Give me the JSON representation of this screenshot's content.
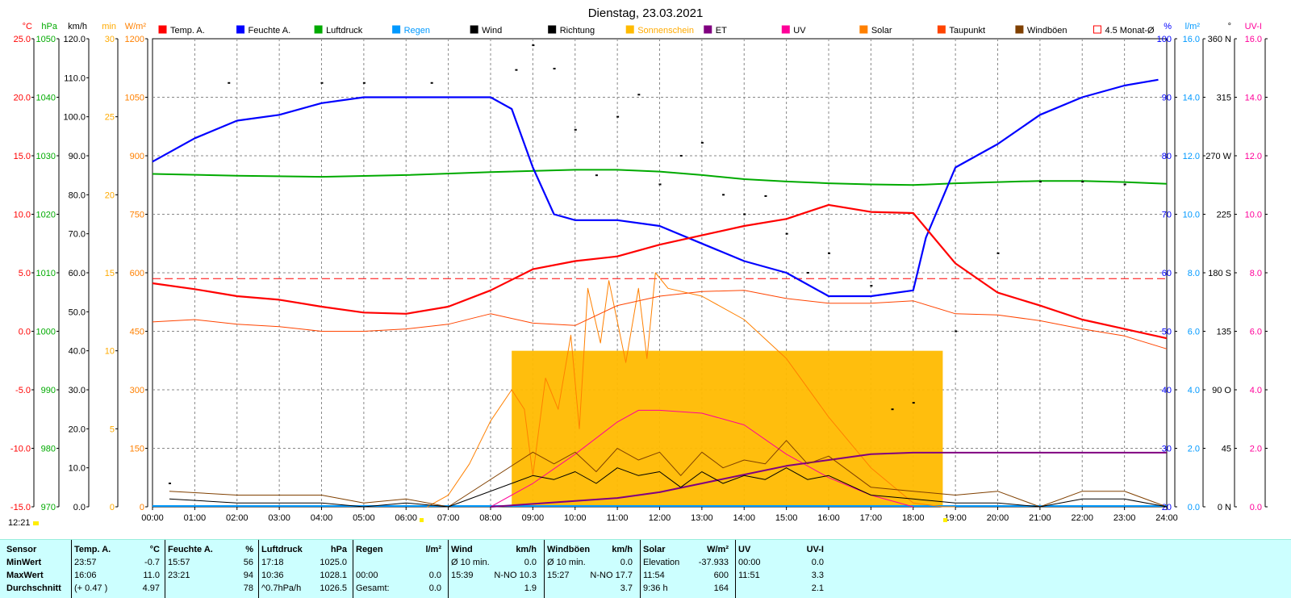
{
  "title": "Dienstag, 23.03.2021",
  "time_now": "12:21",
  "legend": [
    {
      "label": "Temp. A.",
      "color": "#ff0000"
    },
    {
      "label": "Feuchte A.",
      "color": "#0000ff"
    },
    {
      "label": "Luftdruck",
      "color": "#00aa00"
    },
    {
      "label": "Regen",
      "color": "#0099ff"
    },
    {
      "label": "Wind",
      "color": "#000000"
    },
    {
      "label": "Richtung",
      "color": "#000000"
    },
    {
      "label": "Sonnenschein",
      "color": "#ffbb00"
    },
    {
      "label": "ET",
      "color": "#800080"
    },
    {
      "label": "UV",
      "color": "#ff0099"
    },
    {
      "label": "Solar",
      "color": "#ff8000"
    },
    {
      "label": "Taupunkt",
      "color": "#ff4400"
    },
    {
      "label": "Windböen",
      "color": "#804000"
    },
    {
      "label": "4.5 Monat-Ø",
      "color": "#ff0000"
    }
  ],
  "axes_left": [
    {
      "unit": "°C",
      "color": "#ff0000",
      "ticks": [
        "25.0",
        "20.0",
        "15.0",
        "10.0",
        "5.0",
        "0.0",
        "-5.0",
        "-10.0",
        "-15.0"
      ]
    },
    {
      "unit": "hPa",
      "color": "#00aa00",
      "ticks": [
        "1050",
        "1040",
        "1030",
        "1020",
        "1010",
        "1000",
        "990",
        "980",
        "970"
      ]
    },
    {
      "unit": "km/h",
      "color": "#000000",
      "ticks": [
        "120.0",
        "110.0",
        "100.0",
        "90.0",
        "80.0",
        "70.0",
        "60.0",
        "50.0",
        "40.0",
        "30.0",
        "20.0",
        "10.0",
        "0.0"
      ]
    },
    {
      "unit": "min",
      "color": "#ffaa00",
      "ticks": [
        "30",
        "25",
        "20",
        "15",
        "10",
        "5",
        "0"
      ]
    },
    {
      "unit": "W/m²",
      "color": "#ff8000",
      "ticks": [
        "1200",
        "1050",
        "900",
        "750",
        "600",
        "450",
        "300",
        "150",
        "0"
      ]
    }
  ],
  "axes_right": [
    {
      "unit": "%",
      "color": "#0000ff",
      "ticks": [
        "100",
        "90",
        "80",
        "70",
        "60",
        "50",
        "40",
        "30",
        "20"
      ]
    },
    {
      "unit": "l/m²",
      "color": "#0099ff",
      "ticks": [
        "16.0",
        "14.0",
        "12.0",
        "10.0",
        "8.0",
        "6.0",
        "4.0",
        "2.0",
        "0.0"
      ]
    },
    {
      "unit": "°",
      "color": "#000000",
      "ticks": [
        "360 N",
        "315",
        "270 W",
        "225",
        "180 S",
        "135",
        "90 O",
        "45",
        "0 N"
      ]
    },
    {
      "unit": "UV-I",
      "color": "#ff0099",
      "ticks": [
        "16.0",
        "14.0",
        "12.0",
        "10.0",
        "8.0",
        "6.0",
        "4.0",
        "2.0",
        "0.0"
      ]
    }
  ],
  "chart_data": {
    "type": "line",
    "title": "Dienstag, 23.03.2021",
    "x_ticks": [
      "00:00",
      "01:00",
      "02:00",
      "03:00",
      "04:00",
      "05:00",
      "06:00",
      "07:00",
      "08:00",
      "09:00",
      "10:00",
      "11:00",
      "12:00",
      "13:00",
      "14:00",
      "15:00",
      "16:00",
      "17:00",
      "18:00",
      "19:00",
      "20:00",
      "21:00",
      "22:00",
      "23:00",
      "24:00"
    ],
    "xlim": [
      0,
      24
    ],
    "grid": true,
    "legend_placement": "top",
    "series": [
      {
        "name": "Temp. A.",
        "unit": "°C",
        "color": "#ff0000",
        "ylim": [
          -15,
          25
        ],
        "x": [
          0,
          1,
          2,
          3,
          4,
          5,
          6,
          7,
          8,
          9,
          10,
          11,
          12,
          13,
          14,
          15,
          16,
          17,
          18,
          19,
          20,
          21,
          22,
          23,
          24
        ],
        "y": [
          4.1,
          3.6,
          3.0,
          2.7,
          2.1,
          1.6,
          1.5,
          2.1,
          3.5,
          5.3,
          6.0,
          6.4,
          7.4,
          8.2,
          9.0,
          9.6,
          10.8,
          10.2,
          10.1,
          5.8,
          3.3,
          2.2,
          1.0,
          0.2,
          -0.6
        ]
      },
      {
        "name": "Feuchte A.",
        "unit": "%",
        "color": "#0000ff",
        "ylim": [
          20,
          100
        ],
        "x": [
          0,
          1,
          2,
          3,
          4,
          5,
          6,
          7,
          8,
          8.5,
          9,
          9.5,
          10,
          11,
          12,
          13,
          14,
          15,
          16,
          17,
          18,
          18.3,
          19,
          20,
          21,
          22,
          23,
          23.8
        ],
        "y": [
          79,
          83,
          86,
          87,
          89,
          90,
          90,
          90,
          90,
          88,
          78,
          70,
          69,
          69,
          68,
          65,
          62,
          60,
          56,
          56,
          57,
          66,
          78,
          82,
          87,
          90,
          92,
          93
        ]
      },
      {
        "name": "Luftdruck",
        "unit": "hPa",
        "color": "#00aa00",
        "ylim": [
          970,
          1050
        ],
        "x": [
          0,
          2,
          4,
          6,
          8,
          10,
          11,
          12,
          13,
          14,
          15,
          16,
          17,
          18,
          19,
          20,
          21,
          22,
          23,
          24
        ],
        "y": [
          1026.9,
          1026.6,
          1026.4,
          1026.7,
          1027.2,
          1027.6,
          1027.6,
          1027.3,
          1026.7,
          1026.0,
          1025.6,
          1025.3,
          1025.1,
          1025.0,
          1025.3,
          1025.5,
          1025.7,
          1025.7,
          1025.5,
          1025.2
        ]
      },
      {
        "name": "Solar",
        "unit": "W/m²",
        "color": "#ff8000",
        "ylim": [
          0,
          1200
        ],
        "x": [
          6.5,
          7,
          7.5,
          8,
          8.5,
          8.8,
          9,
          9.3,
          9.6,
          9.9,
          10.1,
          10.3,
          10.6,
          10.8,
          11.2,
          11.5,
          11.7,
          11.9,
          12.2,
          13,
          14,
          15,
          16,
          17,
          18,
          18.7,
          19
        ],
        "y": [
          0,
          30,
          110,
          220,
          300,
          250,
          80,
          330,
          250,
          440,
          200,
          560,
          420,
          580,
          370,
          560,
          380,
          600,
          560,
          540,
          480,
          380,
          230,
          100,
          10,
          0,
          0
        ]
      },
      {
        "name": "Taupunkt",
        "unit": "°C",
        "color": "#ff4400",
        "ylim": [
          -15,
          25
        ],
        "x": [
          0,
          1,
          2,
          3,
          4,
          5,
          6,
          7,
          8,
          9,
          10,
          11,
          12,
          13,
          14,
          15,
          16,
          17,
          18,
          19,
          20,
          21,
          22,
          23,
          24
        ],
        "y": [
          0.8,
          1.0,
          0.6,
          0.4,
          0.0,
          0.0,
          0.2,
          0.6,
          1.5,
          0.7,
          0.5,
          2.2,
          3.0,
          3.4,
          3.5,
          2.8,
          2.4,
          2.4,
          2.6,
          1.5,
          1.4,
          0.9,
          0.2,
          -0.4,
          -1.5
        ]
      },
      {
        "name": "UV",
        "unit": "UV-I",
        "color": "#ff0099",
        "ylim": [
          0,
          16
        ],
        "x": [
          8,
          9,
          10,
          11,
          11.5,
          12,
          13,
          14,
          15,
          16,
          17,
          18
        ],
        "y": [
          0,
          0.8,
          1.8,
          2.9,
          3.3,
          3.3,
          3.2,
          2.8,
          1.8,
          1.0,
          0.4,
          0
        ]
      },
      {
        "name": "ET",
        "unit": "l/m²",
        "color": "#800080",
        "ylim": [
          0,
          16
        ],
        "x": [
          8,
          9,
          10,
          11,
          12,
          13,
          14,
          15,
          16,
          17,
          18,
          19,
          24
        ],
        "y": [
          0,
          0.1,
          0.2,
          0.3,
          0.5,
          0.8,
          1.1,
          1.4,
          1.6,
          1.8,
          1.85,
          1.85,
          1.85
        ]
      },
      {
        "name": "Sonnenschein",
        "unit": "min",
        "color": "#ffbb00",
        "ylim": [
          0,
          30
        ],
        "x": [
          8.5,
          18.7
        ],
        "y": [
          10,
          10
        ]
      },
      {
        "name": "Wind",
        "unit": "km/h",
        "color": "#000000",
        "ylim": [
          0,
          120
        ],
        "x": [
          0.4,
          2,
          4,
          5,
          6,
          7,
          9,
          9.5,
          10,
          10.5,
          11,
          11.5,
          12,
          12.5,
          13,
          13.5,
          14,
          14.5,
          15,
          15.5,
          16,
          17,
          18,
          19,
          20,
          21,
          22,
          23,
          24
        ],
        "y": [
          2,
          1,
          1,
          0,
          1,
          0,
          8,
          7,
          9,
          6,
          10,
          8,
          9,
          5,
          9,
          6,
          8,
          7,
          10,
          7,
          8,
          3,
          2,
          1,
          1,
          0,
          2,
          2,
          0
        ]
      },
      {
        "name": "Windböen",
        "unit": "km/h",
        "color": "#804000",
        "ylim": [
          0,
          120
        ],
        "x": [
          0.4,
          2,
          4,
          5,
          6,
          7,
          9,
          9.5,
          10,
          10.5,
          11,
          11.5,
          12,
          12.5,
          13,
          13.5,
          14,
          14.5,
          15,
          15.5,
          16,
          17,
          18,
          19,
          20,
          21,
          22,
          23,
          24
        ],
        "y": [
          4,
          3,
          3,
          1,
          2,
          0,
          14,
          11,
          14,
          9,
          15,
          12,
          14,
          8,
          14,
          10,
          12,
          11,
          17,
          11,
          13,
          5,
          4,
          3,
          4,
          0,
          4,
          4,
          0
        ]
      },
      {
        "name": "Richtung",
        "unit": "°",
        "color": "#000000",
        "ylim": [
          0,
          360
        ],
        "x": [
          0.4,
          1.8,
          4,
          5,
          6.6,
          8.6,
          9,
          9.5,
          10,
          10.5,
          11,
          11.5,
          12,
          12.5,
          13,
          13.5,
          14,
          14.5,
          15,
          15.5,
          16,
          17,
          17.5,
          18,
          19,
          20,
          21,
          22,
          23
        ],
        "y": [
          18,
          326,
          326,
          326,
          326,
          336,
          355,
          337,
          290,
          255,
          300,
          317,
          248,
          270,
          280,
          240,
          225,
          239,
          210,
          180,
          195,
          170,
          75,
          80,
          135,
          195,
          250,
          250,
          248
        ]
      },
      {
        "name": "4.5 Monat-Ø",
        "unit": "°C",
        "color": "#ff0000",
        "ylim": [
          -15,
          25
        ],
        "x": [
          0,
          24
        ],
        "y": [
          4.5,
          4.5
        ]
      }
    ]
  },
  "table": {
    "row_labels": [
      "Sensor",
      "MinWert",
      "MaxWert",
      "Durchschnitt"
    ],
    "columns": [
      {
        "header": "Temp. A.",
        "unit": "°C",
        "rows": [
          [
            "23:57",
            "-0.7"
          ],
          [
            "16:06",
            "11.0"
          ],
          [
            "(+ 0.47 )",
            "4.97"
          ]
        ]
      },
      {
        "header": "Feuchte A.",
        "unit": "%",
        "rows": [
          [
            "15:57",
            "56"
          ],
          [
            "23:21",
            "94"
          ],
          [
            "",
            "78"
          ]
        ]
      },
      {
        "header": "Luftdruck",
        "unit": "hPa",
        "rows": [
          [
            "17:18",
            "1025.0"
          ],
          [
            "10:36",
            "1028.1"
          ],
          [
            "^0.7hPa/h",
            "1026.5"
          ]
        ]
      },
      {
        "header": "Regen",
        "unit": "l/m²",
        "rows": [
          [
            "",
            ""
          ],
          [
            "00:00",
            "0.0"
          ],
          [
            "Gesamt:",
            "0.0"
          ]
        ]
      },
      {
        "header": "Wind",
        "unit": "km/h",
        "rows": [
          [
            "Ø 10 min.",
            "0.0"
          ],
          [
            "15:39",
            "N-NO 10.3"
          ],
          [
            "",
            "1.9"
          ]
        ]
      },
      {
        "header": "Windböen",
        "unit": "km/h",
        "rows": [
          [
            "Ø 10 min.",
            "0.0"
          ],
          [
            "15:27",
            "N-NO 17.7"
          ],
          [
            "",
            "3.7"
          ]
        ]
      },
      {
        "header": "Solar",
        "unit": "W/m²",
        "rows": [
          [
            "Elevation",
            "-37.933"
          ],
          [
            "11:54",
            "600"
          ],
          [
            "9:36 h",
            "164"
          ]
        ]
      },
      {
        "header": "UV",
        "unit": "UV-I",
        "rows": [
          [
            "00:00",
            "0.0"
          ],
          [
            "11:51",
            "3.3"
          ],
          [
            "",
            "2.1"
          ]
        ]
      }
    ]
  }
}
